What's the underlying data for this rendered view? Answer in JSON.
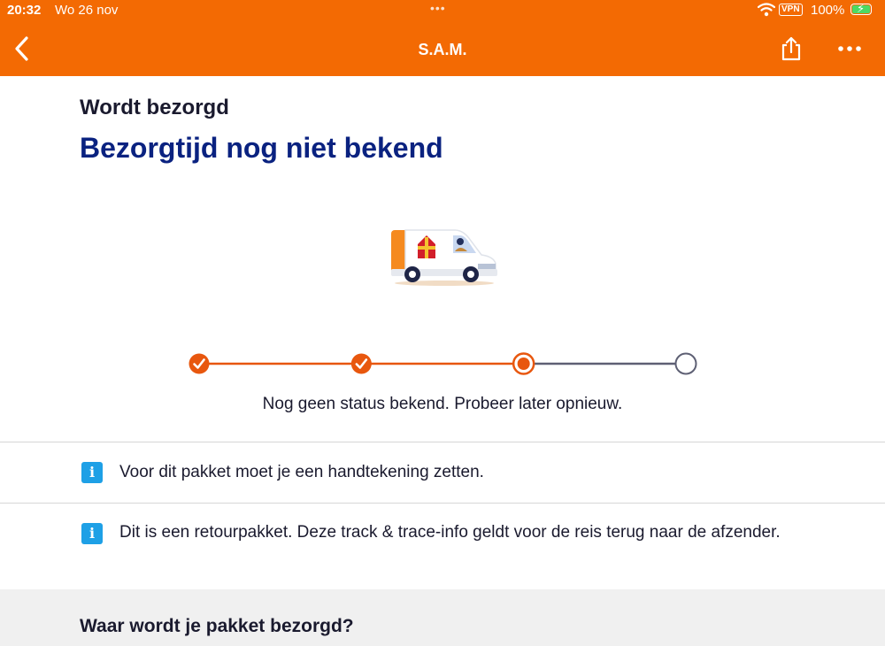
{
  "status_bar": {
    "time": "20:32",
    "date": "Wo 26 nov",
    "vpn": "VPN",
    "battery": "100%"
  },
  "nav": {
    "title": "S.A.M.",
    "back_icon": "chevron-left-icon",
    "share_icon": "share-icon",
    "more_icon": "more-horizontal-icon"
  },
  "delivery": {
    "status_label": "Wordt bezorgd",
    "time_label": "Bezorgtijd nog niet bekend",
    "status_message": "Nog geen status bekend. Probeer later opnieuw.",
    "progress": {
      "steps": 4,
      "completed": 2,
      "current": 3
    }
  },
  "info": [
    {
      "icon": "info-icon",
      "text": "Voor dit pakket moet je een handtekening zetten."
    },
    {
      "icon": "info-icon",
      "text": "Dit is een retourpakket. Deze track & trace-info geldt voor de reis terug naar de afzender."
    }
  ],
  "section": {
    "title": "Waar wordt je pakket bezorgd?"
  },
  "colors": {
    "brand_orange": "#f36a03",
    "progress_orange": "#e8570e",
    "heading_blue": "#0a2280",
    "info_blue": "#1ea0e6",
    "pending_grey": "#5e6074"
  }
}
